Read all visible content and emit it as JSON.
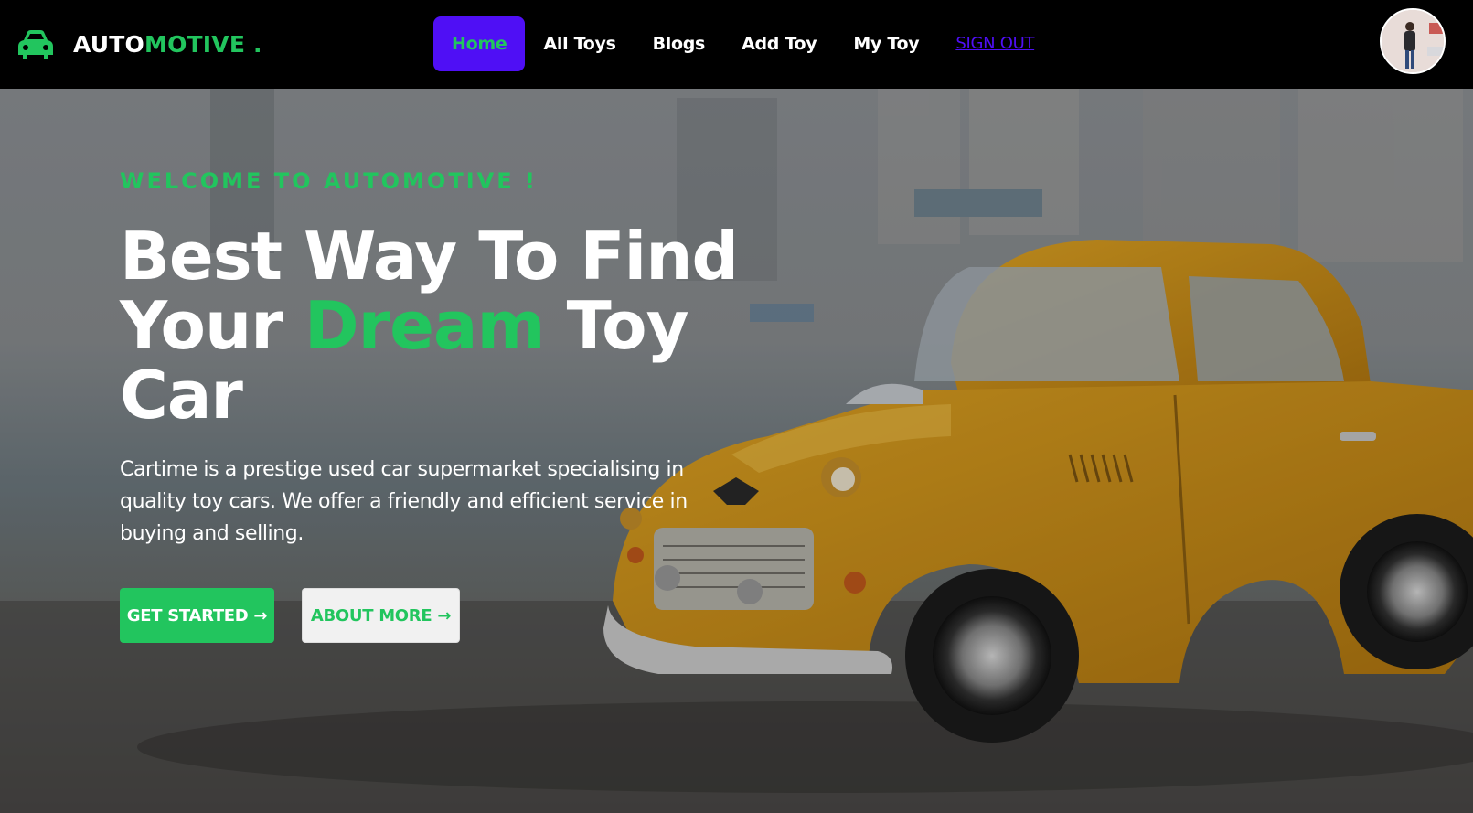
{
  "navbar": {
    "brand_part1": "AUTO",
    "brand_part2": "MOTIVE .",
    "links": [
      {
        "label": "Home"
      },
      {
        "label": "All Toys"
      },
      {
        "label": "Blogs"
      },
      {
        "label": "Add Toy"
      },
      {
        "label": "My Toy"
      }
    ],
    "signout_label": "SIGN OUT"
  },
  "hero": {
    "eyebrow": "WELCOME TO AUTOMOTIVE !",
    "headline_line1": "Best Way To Find",
    "headline_line2_pre": "Your ",
    "headline_line2_accent": "Dream",
    "headline_line2_post": " Toy",
    "headline_line3": "Car",
    "description": "Cartime is a prestige used car supermarket specialising in quality toy cars. We offer a friendly and efficient service in buying and selling.",
    "primary_button": "GET STARTED →",
    "secondary_button": "ABOUT MORE →"
  },
  "colors": {
    "accent_green": "#22c55e",
    "active_nav_bg": "#4f0ff5",
    "navbar_bg": "#000000",
    "toy_car_yellow": "#d99a1c"
  },
  "icons": {
    "brand": "car-icon",
    "avatar": "user-avatar"
  }
}
